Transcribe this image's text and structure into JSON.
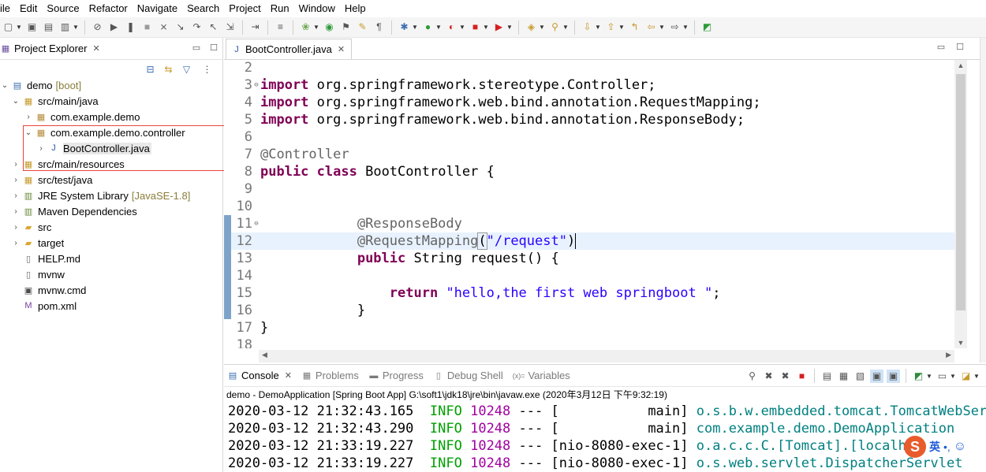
{
  "menu": [
    "ile",
    "Edit",
    "Source",
    "Refactor",
    "Navigate",
    "Search",
    "Project",
    "Run",
    "Window",
    "Help"
  ],
  "toolbar_icons": [
    "new-icon",
    "save-icon",
    "save-all-icon",
    "print-icon",
    "skip-breakpoints-icon",
    "resume-icon",
    "suspend-icon",
    "terminate-icon",
    "disconnect-icon",
    "step-into-icon",
    "step-over-icon",
    "step-return-icon",
    "drop-to-frame-icon",
    "use-step-filters-icon",
    "build-icon",
    "spring-icon",
    "open-type-icon",
    "toggle-mark-icon",
    "toggle-highlight-icon",
    "show-whitespace-icon",
    "debug-icon",
    "run-icon",
    "coverage-icon",
    "stop-icon",
    "external-tools-icon",
    "new-package-icon",
    "search-icon",
    "next-annotation-icon",
    "prev-annotation-icon",
    "last-edit-icon",
    "back-icon",
    "forward-icon",
    "pin-editor-icon"
  ],
  "project_explorer": {
    "title": "Project Explorer",
    "items": [
      {
        "label": "demo",
        "deco": "[boot]",
        "depth": 0,
        "twisty": "open",
        "icon": "project-icon"
      },
      {
        "label": "src/main/java",
        "deco": "",
        "depth": 1,
        "twisty": "open",
        "icon": "source-folder-icon"
      },
      {
        "label": "com.example.demo",
        "deco": "",
        "depth": 2,
        "twisty": "closed",
        "icon": "package-icon"
      },
      {
        "label": "com.example.demo.controller",
        "deco": "",
        "depth": 2,
        "twisty": "open",
        "icon": "package-icon"
      },
      {
        "label": "BootController.java",
        "deco": "",
        "depth": 3,
        "twisty": "closed",
        "icon": "java-file-icon",
        "selected": true
      },
      {
        "label": "src/main/resources",
        "deco": "",
        "depth": 1,
        "twisty": "closed",
        "icon": "source-folder-icon"
      },
      {
        "label": "src/test/java",
        "deco": "",
        "depth": 1,
        "twisty": "closed",
        "icon": "source-folder-icon"
      },
      {
        "label": "JRE System Library",
        "deco": "[JavaSE-1.8]",
        "depth": 1,
        "twisty": "closed",
        "icon": "library-icon"
      },
      {
        "label": "Maven Dependencies",
        "deco": "",
        "depth": 1,
        "twisty": "closed",
        "icon": "library-icon"
      },
      {
        "label": "src",
        "deco": "",
        "depth": 1,
        "twisty": "closed",
        "icon": "folder-icon"
      },
      {
        "label": "target",
        "deco": "",
        "depth": 1,
        "twisty": "closed",
        "icon": "folder-icon"
      },
      {
        "label": "HELP.md",
        "deco": "",
        "depth": 1,
        "twisty": "none",
        "icon": "file-icon"
      },
      {
        "label": "mvnw",
        "deco": "",
        "depth": 1,
        "twisty": "none",
        "icon": "file-icon"
      },
      {
        "label": "mvnw.cmd",
        "deco": "",
        "depth": 1,
        "twisty": "none",
        "icon": "cmd-file-icon"
      },
      {
        "label": "pom.xml",
        "deco": "",
        "depth": 1,
        "twisty": "none",
        "icon": "xml-file-icon"
      }
    ]
  },
  "editor": {
    "tab_title": "BootController.java",
    "lines": [
      {
        "n": "2",
        "fold": "",
        "tokens": []
      },
      {
        "n": "3",
        "fold": "⊖",
        "tokens": [
          {
            "t": "kw",
            "v": "import"
          },
          {
            "t": "plain",
            "v": " org.springframework.stereotype.Controller;"
          }
        ]
      },
      {
        "n": "4",
        "fold": "",
        "tokens": [
          {
            "t": "kw",
            "v": "import"
          },
          {
            "t": "plain",
            "v": " org.springframework.web.bind.annotation.RequestMapping;"
          }
        ]
      },
      {
        "n": "5",
        "fold": "",
        "tokens": [
          {
            "t": "kw",
            "v": "import"
          },
          {
            "t": "plain",
            "v": " org.springframework.web.bind.annotation.ResponseBody;"
          }
        ]
      },
      {
        "n": "6",
        "fold": "",
        "tokens": []
      },
      {
        "n": "7",
        "fold": "",
        "tokens": [
          {
            "t": "ann",
            "v": "@Controller"
          }
        ]
      },
      {
        "n": "8",
        "fold": "",
        "tokens": [
          {
            "t": "kw",
            "v": "public"
          },
          {
            "t": "plain",
            "v": " "
          },
          {
            "t": "kw",
            "v": "class"
          },
          {
            "t": "plain",
            "v": " BootController {"
          }
        ]
      },
      {
        "n": "9",
        "fold": "",
        "tokens": []
      },
      {
        "n": "10",
        "fold": "",
        "tokens": []
      },
      {
        "n": "11",
        "fold": "⊖",
        "tokens": [
          {
            "t": "plain",
            "v": "            "
          },
          {
            "t": "ann",
            "v": "@ResponseBody"
          }
        ]
      },
      {
        "n": "12",
        "fold": "",
        "current": true,
        "tokens": [
          {
            "t": "plain",
            "v": "            "
          },
          {
            "t": "ann",
            "v": "@RequestMapping"
          },
          {
            "t": "bracket",
            "v": "("
          },
          {
            "t": "str",
            "v": "\"/request\""
          },
          {
            "t": "plain",
            "v": ")"
          },
          {
            "t": "caret",
            "v": ""
          }
        ]
      },
      {
        "n": "13",
        "fold": "",
        "tokens": [
          {
            "t": "plain",
            "v": "            "
          },
          {
            "t": "kw",
            "v": "public"
          },
          {
            "t": "plain",
            "v": " String request() {"
          }
        ]
      },
      {
        "n": "14",
        "fold": "",
        "tokens": []
      },
      {
        "n": "15",
        "fold": "",
        "tokens": [
          {
            "t": "plain",
            "v": "                "
          },
          {
            "t": "kw",
            "v": "return"
          },
          {
            "t": "plain",
            "v": " "
          },
          {
            "t": "str",
            "v": "\"hello,the first web springboot \""
          },
          {
            "t": "plain",
            "v": ";"
          }
        ]
      },
      {
        "n": "16",
        "fold": "",
        "tokens": [
          {
            "t": "plain",
            "v": "            }"
          }
        ]
      },
      {
        "n": "17",
        "fold": "",
        "tokens": [
          {
            "t": "plain",
            "v": "}"
          }
        ]
      },
      {
        "n": "18",
        "fold": "",
        "tokens": []
      }
    ]
  },
  "console": {
    "tabs": [
      {
        "label": "Console",
        "active": true,
        "icon": "console-icon"
      },
      {
        "label": "Problems",
        "active": false,
        "icon": "problems-icon"
      },
      {
        "label": "Progress",
        "active": false,
        "icon": "progress-icon"
      },
      {
        "label": "Debug Shell",
        "active": false,
        "icon": "debug-shell-icon"
      },
      {
        "label": "Variables",
        "active": false,
        "icon": "variables-icon"
      }
    ],
    "description": "demo - DemoApplication [Spring Boot App] G:\\soft1\\jdk18\\jre\\bin\\javaw.exe (2020年3月12日 下午9:32:19)",
    "lines": [
      {
        "ts": "2020-03-12 21:32:43.165",
        "level": "INFO",
        "pid": "10248",
        "sep": "---",
        "thread": "[           main]",
        "logger": "o.s.b.w.embedded.tomcat.TomcatWebServe"
      },
      {
        "ts": "2020-03-12 21:32:43.290",
        "level": "INFO",
        "pid": "10248",
        "sep": "---",
        "thread": "[           main]",
        "logger": "com.example.demo.DemoApplication"
      },
      {
        "ts": "2020-03-12 21:33:19.227",
        "level": "INFO",
        "pid": "10248",
        "sep": "---",
        "thread": "[nio-8080-exec-1]",
        "logger": "o.a.c.c.C.[Tomcat].[localhos"
      },
      {
        "ts": "2020-03-12 21:33:19.227",
        "level": "INFO",
        "pid": "10248",
        "sep": "---",
        "thread": "[nio-8080-exec-1]",
        "logger": "o.s.web.servlet.DispatcherServlet"
      }
    ]
  },
  "ime": {
    "logo": "S",
    "lang": "英",
    "dot": "•,",
    "emoji": "☺"
  },
  "colors": {
    "keyword": "#7f0055",
    "annotation": "#646464",
    "string": "#2a00ff",
    "info": "#00a000",
    "logger": "#008080",
    "highlight": "#e8453c"
  }
}
